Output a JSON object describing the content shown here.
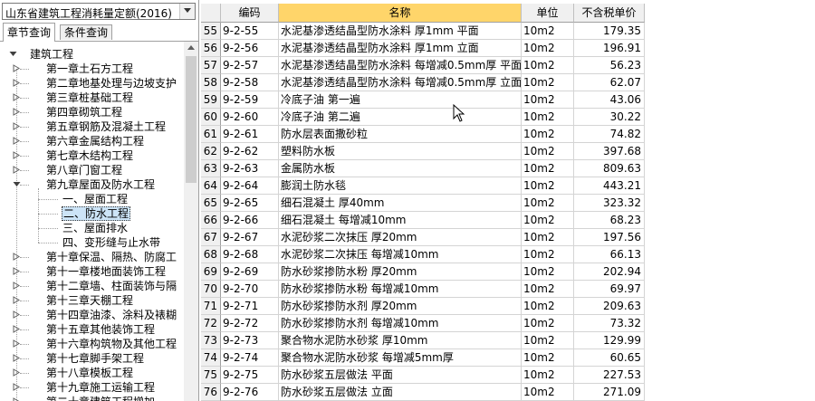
{
  "left_panel": {
    "dataset_select": "山东省建筑工程消耗量定额(2016)",
    "tabs": [
      {
        "label": "章节查询",
        "active": true
      },
      {
        "label": "条件查询",
        "active": false
      }
    ],
    "tree": [
      {
        "label": "建筑工程",
        "level": 0,
        "expander": "minus"
      },
      {
        "label": "第一章土石方工程",
        "level": 1,
        "expander": "plus"
      },
      {
        "label": "第二章地基处理与边坡支护",
        "level": 1,
        "expander": "plus"
      },
      {
        "label": "第三章桩基础工程",
        "level": 1,
        "expander": "plus"
      },
      {
        "label": "第四章砌筑工程",
        "level": 1,
        "expander": "plus"
      },
      {
        "label": "第五章钢筋及混凝土工程",
        "level": 1,
        "expander": "plus"
      },
      {
        "label": "第六章金属结构工程",
        "level": 1,
        "expander": "plus"
      },
      {
        "label": "第七章木结构工程",
        "level": 1,
        "expander": "plus"
      },
      {
        "label": "第八章门窗工程",
        "level": 1,
        "expander": "plus"
      },
      {
        "label": "第九章屋面及防水工程",
        "level": 1,
        "expander": "minus"
      },
      {
        "label": "一、屋面工程",
        "level": 2,
        "expander": "none"
      },
      {
        "label": "二、防水工程",
        "level": 2,
        "expander": "none",
        "selected": true
      },
      {
        "label": "三、屋面排水",
        "level": 2,
        "expander": "none"
      },
      {
        "label": "四、变形缝与止水带",
        "level": 2,
        "expander": "none"
      },
      {
        "label": "第十章保温、隔热、防腐工",
        "level": 1,
        "expander": "plus"
      },
      {
        "label": "第十一章楼地面装饰工程",
        "level": 1,
        "expander": "plus"
      },
      {
        "label": "第十二章墙、柱面装饰与隔",
        "level": 1,
        "expander": "plus"
      },
      {
        "label": "第十三章天棚工程",
        "level": 1,
        "expander": "plus"
      },
      {
        "label": "第十四章油漆、涂料及裱糊",
        "level": 1,
        "expander": "plus"
      },
      {
        "label": "第十五章其他装饰工程",
        "level": 1,
        "expander": "plus"
      },
      {
        "label": "第十六章构筑物及其他工程",
        "level": 1,
        "expander": "plus"
      },
      {
        "label": "第十七章脚手架工程",
        "level": 1,
        "expander": "plus"
      },
      {
        "label": "第十八章模板工程",
        "level": 1,
        "expander": "plus"
      },
      {
        "label": "第十九章施工运输工程",
        "level": 1,
        "expander": "plus"
      },
      {
        "label": "第二十章建筑工程增加",
        "level": 1,
        "expander": "plus"
      }
    ]
  },
  "grid": {
    "headers": {
      "num": "",
      "code": "编码",
      "name": "名称",
      "unit": "单位",
      "price": "不含税单价"
    },
    "active_header": "name",
    "rows": [
      {
        "num": "55",
        "code": "9-2-55",
        "name": "水泥基渗透结晶型防水涂料 厚1mm 平面",
        "unit": "10m2",
        "price": "179.35"
      },
      {
        "num": "56",
        "code": "9-2-56",
        "name": "水泥基渗透结晶型防水涂料 厚1mm 立面",
        "unit": "10m2",
        "price": "196.91"
      },
      {
        "num": "57",
        "code": "9-2-57",
        "name": "水泥基渗透结晶型防水涂料 每增减0.5mm厚 平面",
        "unit": "10m2",
        "price": "56.23"
      },
      {
        "num": "58",
        "code": "9-2-58",
        "name": "水泥基渗透结晶型防水涂料 每增减0.5mm厚 立面",
        "unit": "10m2",
        "price": "62.07"
      },
      {
        "num": "59",
        "code": "9-2-59",
        "name": "冷底子油 第一遍",
        "unit": "10m2",
        "price": "43.06"
      },
      {
        "num": "60",
        "code": "9-2-60",
        "name": "冷底子油 第二遍",
        "unit": "10m2",
        "price": "30.22"
      },
      {
        "num": "61",
        "code": "9-2-61",
        "name": "防水层表面撒砂粒",
        "unit": "10m2",
        "price": "74.82"
      },
      {
        "num": "62",
        "code": "9-2-62",
        "name": "塑料防水板",
        "unit": "10m2",
        "price": "397.68"
      },
      {
        "num": "63",
        "code": "9-2-63",
        "name": "金属防水板",
        "unit": "10m2",
        "price": "809.63"
      },
      {
        "num": "64",
        "code": "9-2-64",
        "name": "膨润土防水毯",
        "unit": "10m2",
        "price": "443.21"
      },
      {
        "num": "65",
        "code": "9-2-65",
        "name": "细石混凝土 厚40mm",
        "unit": "10m2",
        "price": "323.32"
      },
      {
        "num": "66",
        "code": "9-2-66",
        "name": "细石混凝土 每增减10mm",
        "unit": "10m2",
        "price": "68.23"
      },
      {
        "num": "67",
        "code": "9-2-67",
        "name": "水泥砂浆二次抹压 厚20mm",
        "unit": "10m2",
        "price": "197.56"
      },
      {
        "num": "68",
        "code": "9-2-68",
        "name": "水泥砂浆二次抹压 每增减10mm",
        "unit": "10m2",
        "price": "66.13"
      },
      {
        "num": "69",
        "code": "9-2-69",
        "name": "防水砂浆掺防水粉 厚20mm",
        "unit": "10m2",
        "price": "202.94"
      },
      {
        "num": "70",
        "code": "9-2-70",
        "name": "防水砂浆掺防水粉 每增减10mm",
        "unit": "10m2",
        "price": "69.97"
      },
      {
        "num": "71",
        "code": "9-2-71",
        "name": "防水砂浆掺防水剂 厚20mm",
        "unit": "10m2",
        "price": "209.63"
      },
      {
        "num": "72",
        "code": "9-2-72",
        "name": "防水砂浆掺防水剂 每增减10mm",
        "unit": "10m2",
        "price": "73.32"
      },
      {
        "num": "73",
        "code": "9-2-73",
        "name": "聚合物水泥防水砂浆 厚10mm",
        "unit": "10m2",
        "price": "129.99"
      },
      {
        "num": "74",
        "code": "9-2-74",
        "name": "聚合物水泥防水砂浆 每增减5mm厚",
        "unit": "10m2",
        "price": "60.65"
      },
      {
        "num": "75",
        "code": "9-2-75",
        "name": "防水砂浆五层做法 平面",
        "unit": "10m2",
        "price": "227.53"
      },
      {
        "num": "76",
        "code": "9-2-76",
        "name": "防水砂浆五层做法 立面",
        "unit": "10m2",
        "price": "271.09"
      }
    ]
  },
  "colors": {
    "active_header": "#ffd56a",
    "selection": "#cce4f7",
    "grid_line": "#d4d4d4"
  },
  "icons": {
    "combo_arrow": "chevron-down-icon",
    "tree_expand": "plus-box-icon",
    "tree_collapse": "minus-box-icon",
    "cursor": "mouse-cursor-icon"
  }
}
